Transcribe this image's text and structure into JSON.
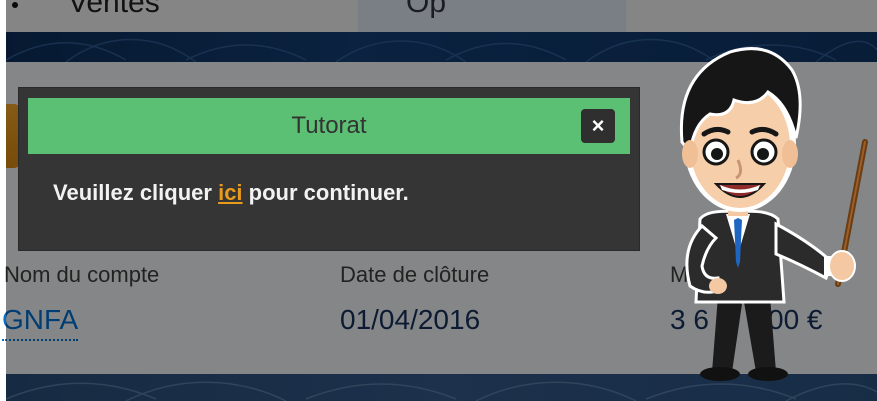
{
  "app": {
    "nav_tab_label": "Ventes",
    "nav_tab_active_label": "Op"
  },
  "record": {
    "fields": [
      {
        "label": "Nom du compte",
        "value": "GNFA"
      },
      {
        "label": "Date de clôture",
        "value": "01/04/2016"
      },
      {
        "label": "M",
        "value": "3 6",
        "value_right": "00 €"
      }
    ]
  },
  "tutorial": {
    "title": "Tutorat",
    "close_label": "×",
    "message_before": "Veuillez cliquer ",
    "link_text": "ici",
    "message_after": " pour continuer."
  },
  "colors": {
    "header_green": "#5bc073",
    "dialog_bg": "#353535",
    "link_orange": "#e89a1c",
    "band_navy": "#0d2f5b"
  },
  "icons": {
    "close": "close-icon",
    "mascot": "teacher-mascot"
  }
}
